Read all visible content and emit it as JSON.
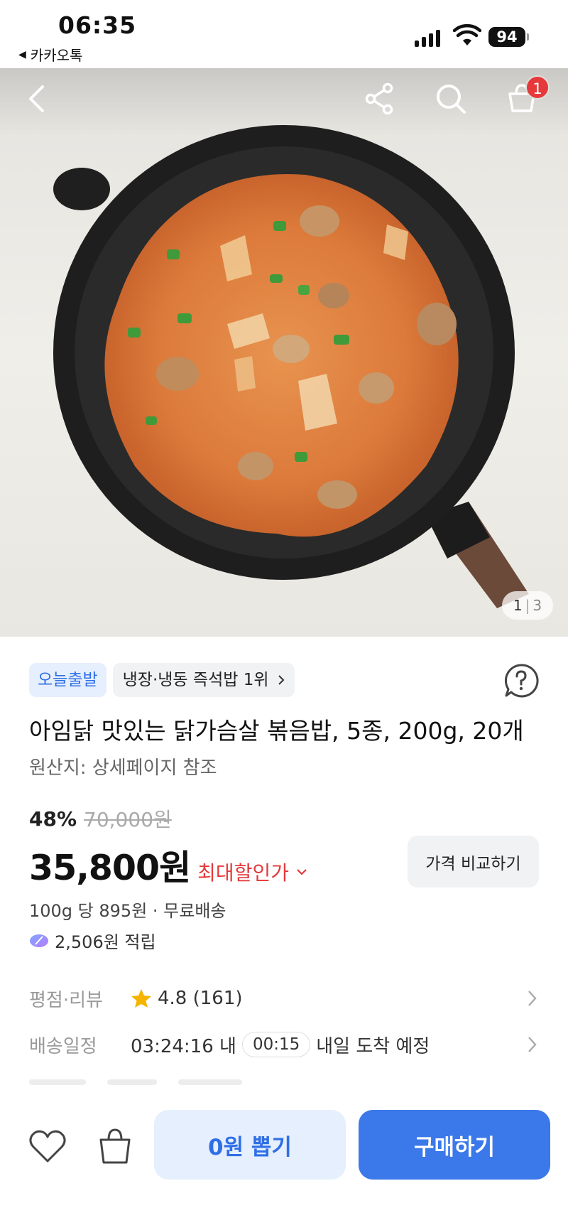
{
  "status_bar": {
    "time": "06:35",
    "back_app": "카카오톡",
    "battery": "94"
  },
  "hero": {
    "image_description_icon": "product-photo",
    "cart_count": "1",
    "page_current": "1",
    "page_separator": "|",
    "page_total": "3"
  },
  "product": {
    "tag_today": "오늘출발",
    "tag_rank": "냉장·냉동 즉석밥 1위",
    "title": "아임닭 맛있는 닭가슴살 볶음밥, 5종, 200g, 20개",
    "origin": "원산지: 상세페이지 참조",
    "discount_rate": "48%",
    "original_price": "70,000원",
    "price": "35,800원",
    "best_price_label": "최대할인가",
    "compare_button": "가격 비교하기",
    "unit_price": "100g 당 895원 · 무료배송",
    "points": "2,506원 적립"
  },
  "info_rows": {
    "rating_label": "평점·리뷰",
    "rating_value": "4.8 (161)",
    "delivery_label": "배송일정",
    "delivery_time": "03:24:16 내",
    "delivery_chip": "00:15",
    "delivery_arrival": "내일 도착 예정"
  },
  "bottom_bar": {
    "draw_button": "0원 뽑기",
    "buy_button": "구매하기"
  },
  "colors": {
    "accent_blue": "#3b78ea",
    "light_blue_bg": "#e6effd",
    "discount_red": "#e5393b",
    "star": "#f5b400"
  }
}
